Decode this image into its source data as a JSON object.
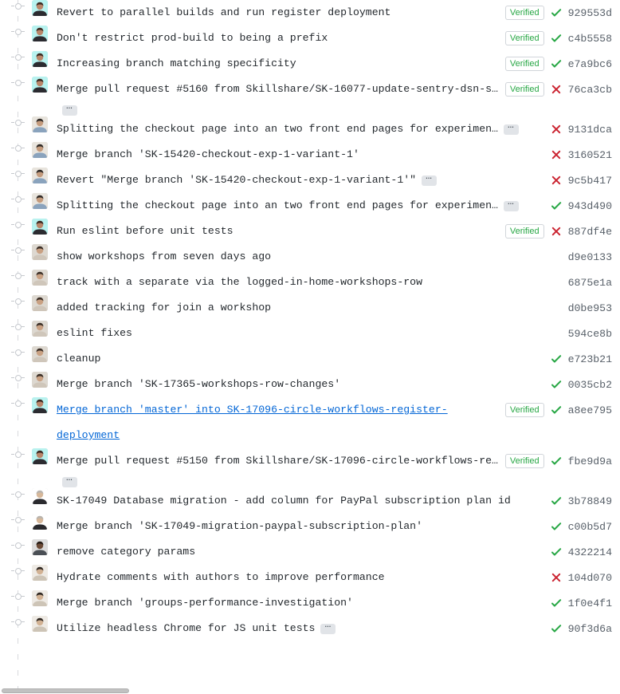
{
  "view": {
    "name": "github-commit-history",
    "verified_label": "Verified",
    "ellipsis_label": "…",
    "colors": {
      "text": "#24292e",
      "link": "#0366d6",
      "sha": "#586069",
      "success": "#28a745",
      "failure": "#cb2431",
      "badge_border": "#d1d5da",
      "rail": "#c6c9ce"
    }
  },
  "commits": [
    {
      "message": "Revert to parallel builds and run register deployment",
      "verified": true,
      "status": "success",
      "sha": "929553d",
      "avatar": "a",
      "truncated": false,
      "link": false
    },
    {
      "message": "Don't restrict prod-build to being a prefix",
      "verified": true,
      "status": "success",
      "sha": "c4b5558",
      "avatar": "a",
      "truncated": false,
      "link": false
    },
    {
      "message": "Increasing branch matching specificity",
      "verified": true,
      "status": "success",
      "sha": "e7a9bc6",
      "avatar": "a",
      "truncated": false,
      "link": false
    },
    {
      "message": "Merge pull request #5160 from Skillshare/SK-16077-update-sentry-dsn-s…",
      "verified": true,
      "status": "failure",
      "sha": "76ca3cb",
      "avatar": "a",
      "truncated": true,
      "link": false
    },
    {
      "message": "Splitting the checkout page into an two front end pages for experimen…",
      "verified": false,
      "status": "failure",
      "sha": "9131dca",
      "avatar": "b",
      "truncated": true,
      "link": false
    },
    {
      "message": "Merge branch 'SK-15420-checkout-exp-1-variant-1'",
      "verified": false,
      "status": "failure",
      "sha": "3160521",
      "avatar": "b",
      "truncated": false,
      "link": false
    },
    {
      "message": "Revert \"Merge branch 'SK-15420-checkout-exp-1-variant-1'\"",
      "verified": false,
      "status": "failure",
      "sha": "9c5b417",
      "avatar": "b",
      "truncated": true,
      "link": false
    },
    {
      "message": "Splitting the checkout page into an two front end pages for experimen…",
      "verified": false,
      "status": "success",
      "sha": "943d490",
      "avatar": "b",
      "truncated": true,
      "link": false
    },
    {
      "message": "Run eslint before unit tests",
      "verified": true,
      "status": "failure",
      "sha": "887df4e",
      "avatar": "a",
      "truncated": false,
      "link": false
    },
    {
      "message": "show workshops from seven days ago",
      "verified": false,
      "status": "none",
      "sha": "d9e0133",
      "avatar": "c",
      "truncated": false,
      "link": false
    },
    {
      "message": "track with a separate via the logged-in-home-workshops-row",
      "verified": false,
      "status": "none",
      "sha": "6875e1a",
      "avatar": "c",
      "truncated": false,
      "link": false
    },
    {
      "message": "added tracking for join a workshop",
      "verified": false,
      "status": "none",
      "sha": "d0be953",
      "avatar": "c",
      "truncated": false,
      "link": false
    },
    {
      "message": "eslint fixes",
      "verified": false,
      "status": "none",
      "sha": "594ce8b",
      "avatar": "c",
      "truncated": false,
      "link": false
    },
    {
      "message": "cleanup",
      "verified": false,
      "status": "success",
      "sha": "e723b21",
      "avatar": "c",
      "truncated": false,
      "link": false
    },
    {
      "message": "Merge branch 'SK-17365-workshops-row-changes'",
      "verified": false,
      "status": "success",
      "sha": "0035cb2",
      "avatar": "c",
      "truncated": false,
      "link": false
    },
    {
      "message": "Merge branch 'master' into SK-17096-circle-workflows-register-deployment",
      "verified": true,
      "status": "success",
      "sha": "a8ee795",
      "avatar": "a",
      "truncated": false,
      "link": true
    },
    {
      "message": "Merge pull request #5150 from Skillshare/SK-17096-circle-workflows-re…",
      "verified": true,
      "status": "success",
      "sha": "fbe9d9a",
      "avatar": "a",
      "truncated": true,
      "link": false
    },
    {
      "message": "SK-17049 Database migration - add column for PayPal subscription plan id",
      "verified": false,
      "status": "success",
      "sha": "3b78849",
      "avatar": "d",
      "truncated": false,
      "link": false
    },
    {
      "message": "Merge branch 'SK-17049-migration-paypal-subscription-plan'",
      "verified": false,
      "status": "success",
      "sha": "c00b5d7",
      "avatar": "d",
      "truncated": false,
      "link": false
    },
    {
      "message": "remove category params",
      "verified": false,
      "status": "success",
      "sha": "4322214",
      "avatar": "e",
      "truncated": false,
      "link": false
    },
    {
      "message": "Hydrate comments with authors to improve performance",
      "verified": false,
      "status": "failure",
      "sha": "104d070",
      "avatar": "f",
      "truncated": false,
      "link": false
    },
    {
      "message": "Merge branch 'groups-performance-investigation'",
      "verified": false,
      "status": "success",
      "sha": "1f0e4f1",
      "avatar": "f",
      "truncated": false,
      "link": false
    },
    {
      "message": "Utilize headless Chrome for JS unit tests",
      "verified": false,
      "status": "success",
      "sha": "90f3d6a",
      "avatar": "f",
      "truncated": true,
      "link": false
    }
  ]
}
